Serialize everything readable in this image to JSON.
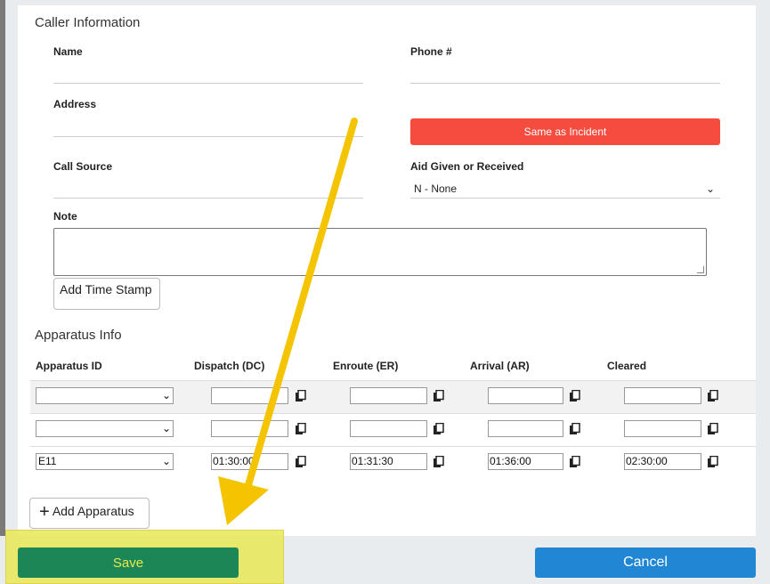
{
  "caller": {
    "title": "Caller Information",
    "name_label": "Name",
    "phone_label": "Phone #",
    "address_label": "Address",
    "same_as_incident": "Same as Incident",
    "call_source_label": "Call Source",
    "aid_label": "Aid Given or Received",
    "aid_value": "N - None",
    "note_label": "Note",
    "add_time_stamp": "Add Time Stamp"
  },
  "apparatus": {
    "title": "Apparatus Info",
    "columns": [
      "Apparatus ID",
      "Dispatch (DC)",
      "Enroute (ER)",
      "Arrival (AR)",
      "Cleared"
    ],
    "rows": [
      {
        "id": "",
        "dispatch": "",
        "enroute": "",
        "arrival": "",
        "cleared": ""
      },
      {
        "id": "",
        "dispatch": "",
        "enroute": "",
        "arrival": "",
        "cleared": ""
      },
      {
        "id": "E11",
        "dispatch": "01:30:00",
        "enroute": "01:31:30",
        "arrival": "01:36:00",
        "cleared": "02:30:00"
      }
    ],
    "add_apparatus": "Add Apparatus"
  },
  "footer": {
    "save": "Save",
    "cancel": "Cancel"
  },
  "colors": {
    "same_as_incident": "#f44d3f",
    "save": "#1b8756",
    "cancel": "#2187d5",
    "highlight": "#e8e856",
    "arrow": "#f5c400"
  },
  "icons": [
    "copy-icon",
    "chevron-down-icon",
    "plus-icon",
    "arrow-annotation"
  ]
}
